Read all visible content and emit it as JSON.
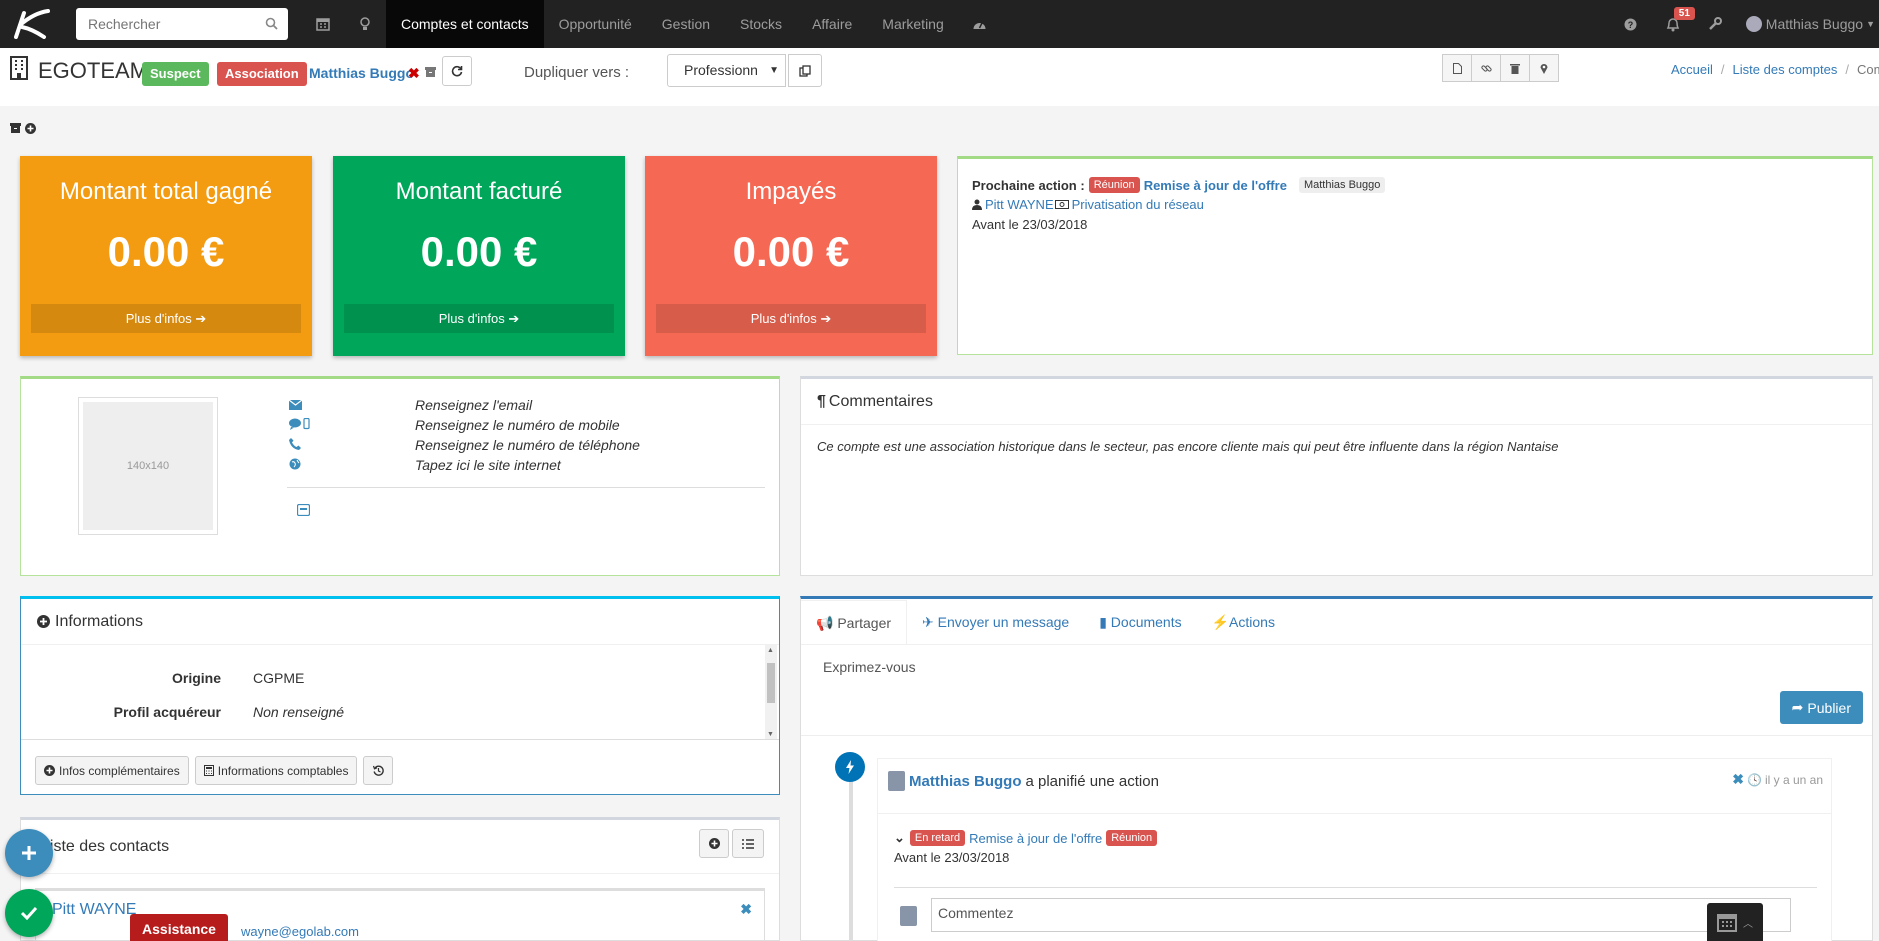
{
  "nav": {
    "search_placeholder": "Rechercher",
    "items": [
      "Comptes et contacts",
      "Opportunité",
      "Gestion",
      "Stocks",
      "Affaire",
      "Marketing"
    ],
    "active": "Comptes et contacts",
    "notifications": "51",
    "user": "Matthias Buggo"
  },
  "header": {
    "account_name": "EGOTEAM",
    "status_label": "Suspect",
    "type_label": "Association",
    "owner": "Matthias Buggo",
    "duplicate_label": "Dupliquer vers :",
    "duplicate_value": "Professionn"
  },
  "breadcrumb": [
    "Accueil",
    "Liste des comptes",
    "Compte"
  ],
  "kpis": [
    {
      "title": "Montant total gagné",
      "value": "0.00 €",
      "more": "Plus d'infos",
      "color": "#f39c12"
    },
    {
      "title": "Montant facturé",
      "value": "0.00 €",
      "more": "Plus d'infos",
      "color": "#00a65a"
    },
    {
      "title": "Impayés",
      "value": "0.00 €",
      "more": "Plus d'infos",
      "color": "#f56954"
    }
  ],
  "next_action": {
    "label": "Prochaine action :",
    "type": "Réunion",
    "title": "Remise à jour de l'offre",
    "owner": "Matthias Buggo",
    "contact": "Pitt WAYNE",
    "opportunity": "Privatisation du réseau",
    "deadline": "Avant le 23/03/2018"
  },
  "contact_info": {
    "photo_placeholder": "140x140",
    "email": "Renseignez l'email",
    "mobile": "Renseignez le numéro de mobile",
    "phone": "Renseignez le numéro de téléphone",
    "website": "Tapez ici le site internet"
  },
  "comments": {
    "title": "Commentaires",
    "text": "Ce compte est une association historique dans le secteur, pas encore cliente mais qui peut être influente dans la région Nantaise"
  },
  "informations": {
    "title": "Informations",
    "rows": [
      {
        "key": "Origine",
        "value": "CGPME"
      },
      {
        "key": "Profil acquéreur",
        "value": "Non renseigné"
      }
    ],
    "buttons": [
      "Infos complémentaires",
      "Informations comptables"
    ]
  },
  "feed": {
    "tabs": [
      "Partager",
      "Envoyer un message",
      "Documents",
      "Actions"
    ],
    "placeholder": "Exprimez-vous",
    "publish": "Publier",
    "item": {
      "author": "Matthias Buggo",
      "verb": "a planifié une action",
      "time": "il y a un an",
      "status": "En retard",
      "title": "Remise à jour de l'offre",
      "type": "Réunion",
      "deadline": "Avant le 23/03/2018",
      "comment_placeholder": "Commentez"
    }
  },
  "contacts": {
    "title": "Liste des contacts",
    "first_name": "Pitt WAYNE",
    "first_email": "wayne@egolab.com"
  },
  "assistance": "Assistance"
}
